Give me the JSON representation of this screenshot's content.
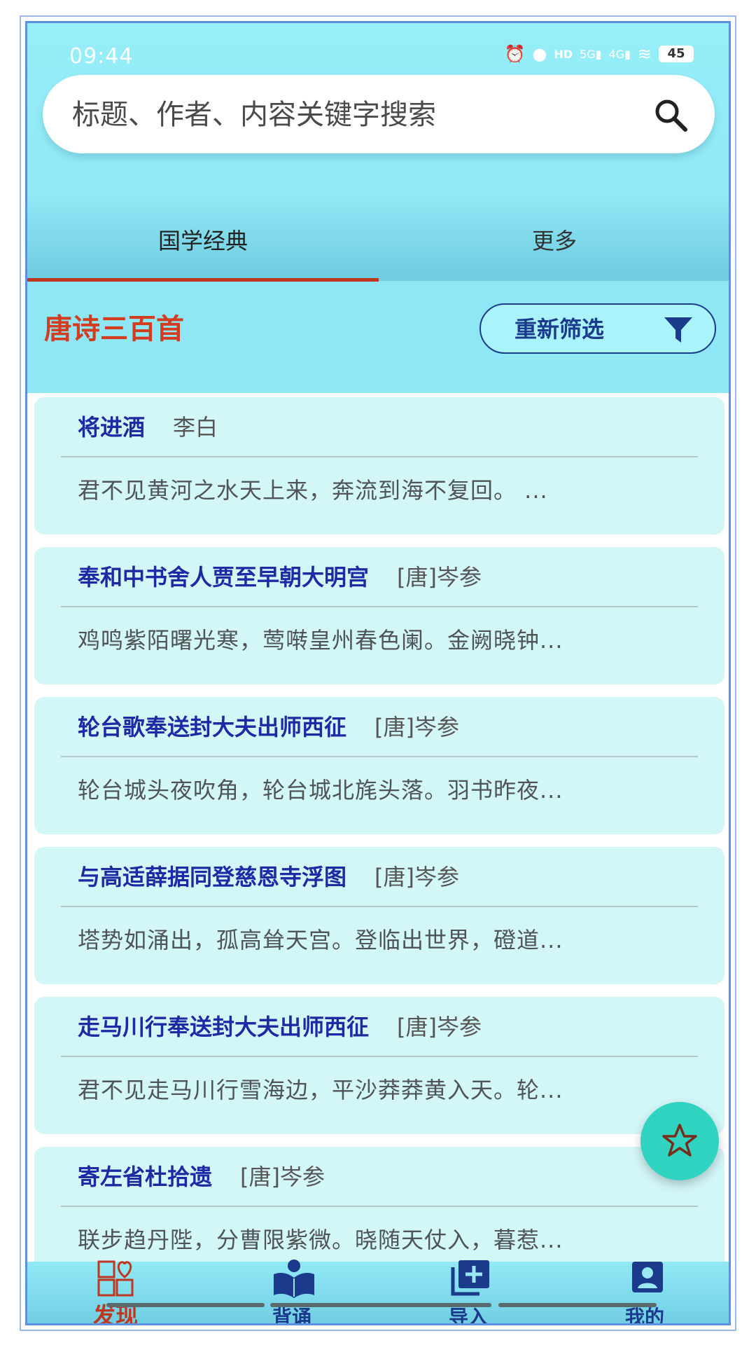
{
  "status_bar": {
    "time": "09:44",
    "battery": "45",
    "icons": [
      "alarm-icon",
      "mic-icon",
      "hd-icon",
      "5g-signal-icon",
      "4g-signal-icon",
      "wifi-icon",
      "battery-icon"
    ]
  },
  "search": {
    "placeholder": "标题、作者、内容关键字搜索"
  },
  "tabs": [
    {
      "label": "国学经典",
      "active": true
    },
    {
      "label": "更多",
      "active": false
    }
  ],
  "filter_bar": {
    "collection_title": "唐诗三百首",
    "refilter_label": "重新筛选"
  },
  "poems": [
    {
      "title": "将进酒",
      "author": "李白",
      "excerpt": "君不见黄河之水天上来，奔流到海不复回。 ..."
    },
    {
      "title": "奉和中书舍人贾至早朝大明宫",
      "author": "[唐]岑参",
      "excerpt": "鸡鸣紫陌曙光寒，莺啭皇州春色阑。金阙晓钟..."
    },
    {
      "title": "轮台歌奉送封大夫出师西征",
      "author": "[唐]岑参",
      "excerpt": "轮台城头夜吹角，轮台城北旄头落。羽书昨夜..."
    },
    {
      "title": "与高适薛据同登慈恩寺浮图",
      "author": "[唐]岑参",
      "excerpt": "塔势如涌出，孤高耸天宫。登临出世界，磴道..."
    },
    {
      "title": "走马川行奉送封大夫出师西征",
      "author": "[唐]岑参",
      "excerpt": "君不见走马川行雪海边，平沙莽莽黄入天。轮..."
    },
    {
      "title": "寄左省杜拾遗",
      "author": "[唐]岑参",
      "excerpt": "联步趋丹陛，分曹限紫微。晓随天仗入，暮惹..."
    }
  ],
  "fab": {
    "icon": "star-icon"
  },
  "bottom_nav": [
    {
      "label": "发现",
      "icon": "discover-icon",
      "active": true
    },
    {
      "label": "背诵",
      "icon": "recite-icon",
      "active": false
    },
    {
      "label": "导入",
      "icon": "import-icon",
      "active": false
    },
    {
      "label": "我的",
      "icon": "profile-icon",
      "active": false
    }
  ],
  "colors": {
    "accent": "#c0371f",
    "title_blue": "#1c2aa4",
    "fab": "#2fd3c0",
    "background": "#8fe6f4",
    "card": "#d3f6f7"
  }
}
